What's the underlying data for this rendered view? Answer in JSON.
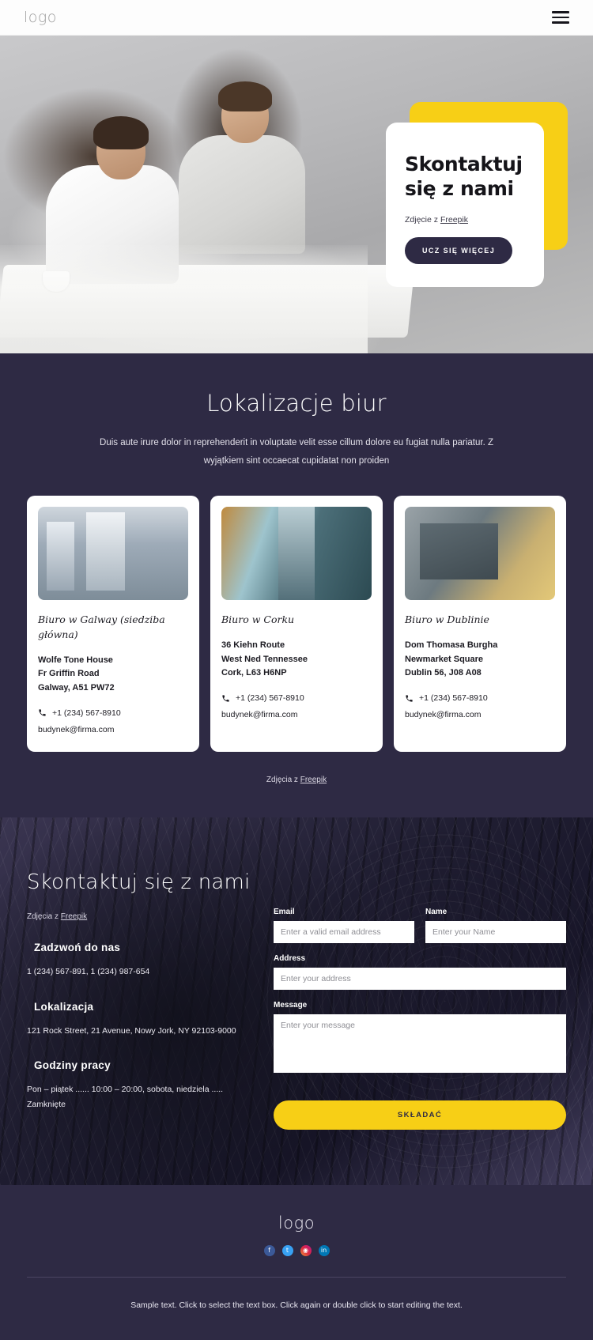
{
  "header": {
    "logo": "logo",
    "menu_icon": "hamburger-menu-icon"
  },
  "hero": {
    "title": "Skontaktuj się z nami",
    "credit_prefix": "Zdjęcie z ",
    "credit_link": "Freepik",
    "cta_label": "UCZ SIĘ WIĘCEJ"
  },
  "locations": {
    "heading": "Lokalizacje biur",
    "lead": "Duis aute irure dolor in reprehenderit in voluptate velit esse cillum dolore eu fugiat nulla pariatur. Z wyjątkiem sint occaecat cupidatat non proiden",
    "credit_prefix": "Zdjęcia z ",
    "credit_link": "Freepik",
    "cards": [
      {
        "photo": "city-skyscrapers-photo",
        "title": "Biuro w Galway (siedziba główna)",
        "address": [
          "Wolfe Tone House",
          "Fr Griffin Road",
          "Galway, A51 PW72"
        ],
        "phone": "+1 (234) 567-8910",
        "email": "budynek@firma.com"
      },
      {
        "photo": "glass-corridor-photo",
        "title": "Biuro w Corku",
        "address": [
          "36 Kiehn Route",
          "West Ned Tennessee",
          "Cork, L63 H6NP"
        ],
        "phone": "+1 (234) 567-8910",
        "email": "budynek@firma.com"
      },
      {
        "photo": "modern-office-building-photo",
        "title": "Biuro w Dublinie",
        "address": [
          "Dom Thomasa Burgha",
          "Newmarket Square",
          "Dublin 56, J08 A08"
        ],
        "phone": "+1 (234) 567-8910",
        "email": "budynek@firma.com"
      }
    ]
  },
  "contact": {
    "heading": "Skontaktuj się z nami",
    "credit_prefix": "Zdjęcia z ",
    "credit_link": "Freepik",
    "blocks": [
      {
        "title": "Zadzwoń do nas",
        "text": "1 (234) 567-891, 1 (234) 987-654"
      },
      {
        "title": "Lokalizacja",
        "text": "121 Rock Street, 21 Avenue, Nowy Jork, NY 92103-9000"
      },
      {
        "title": "Godziny pracy",
        "text": "Pon – piątek ...... 10:00 – 20:00, sobota, niedziela ..... Zamknięte"
      }
    ],
    "form": {
      "email_label": "Email",
      "email_placeholder": "Enter a valid email address",
      "email_value": "",
      "name_label": "Name",
      "name_placeholder": "Enter your Name",
      "name_value": "",
      "address_label": "Address",
      "address_placeholder": "Enter your address",
      "address_value": "",
      "message_label": "Message",
      "message_placeholder": "Enter your message",
      "message_value": "",
      "submit_label": "SKŁADAĆ"
    }
  },
  "footer": {
    "logo": "logo",
    "socials": [
      {
        "name": "facebook-icon",
        "glyph": "f"
      },
      {
        "name": "twitter-icon",
        "glyph": "t"
      },
      {
        "name": "instagram-icon",
        "glyph": "◉"
      },
      {
        "name": "linkedin-icon",
        "glyph": "in"
      }
    ],
    "fine_print": "Sample text. Click to select the text box. Click again or double click to start editing the text."
  },
  "colors": {
    "brand_dark": "#2e2a44",
    "accent_yellow": "#f7cf16",
    "white": "#ffffff"
  }
}
